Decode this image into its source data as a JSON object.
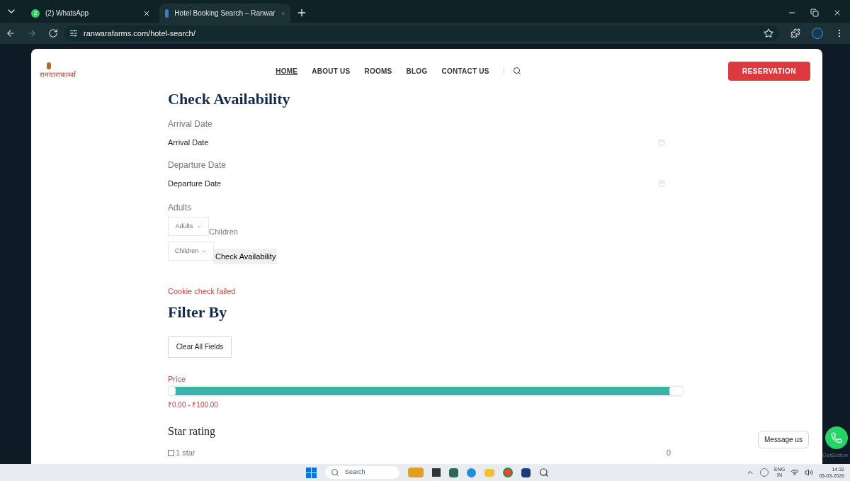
{
  "browser": {
    "tabs": [
      {
        "title": "(2) WhatsApp",
        "badge": "2",
        "selected": false
      },
      {
        "title": "Hotel Booking Search – Ranwar",
        "selected": true
      }
    ],
    "address": "ranwarafarms.com/hotel-search/"
  },
  "header": {
    "logo": "रानवाराफार्म्स",
    "nav": [
      {
        "label": "HOME",
        "selected": true
      },
      {
        "label": "ABOUT US",
        "selected": false
      },
      {
        "label": "ROOMS",
        "selected": false
      },
      {
        "label": "BLOG",
        "selected": false
      },
      {
        "label": "CONTACT US",
        "selected": false
      }
    ],
    "reservation": "RESERVATION"
  },
  "availability": {
    "title": "Check Availability",
    "dates": [
      {
        "label": "Arrival Date",
        "placeholder": "Arrival Date"
      },
      {
        "label": "Departure Date",
        "placeholder": "Departure Date"
      }
    ],
    "adults_label": "Adults",
    "adults_select": "Adults",
    "children_label": "Children",
    "children_select": "Children",
    "submit": "Check Availability",
    "error": "Cookie check failed"
  },
  "filter": {
    "title": "Filter By",
    "clear": "Clear All Fields",
    "price_label": "Price",
    "price": {
      "level": 1
    },
    "price_range": "₹0.00 - ₹100.00",
    "star_title": "Star rating",
    "stars": [
      {
        "label": "1 star",
        "checked": false,
        "count": "0"
      }
    ]
  },
  "chat": {
    "message": "Message us",
    "credit": "GetButton"
  },
  "taskbar": {
    "search": "Search",
    "lang": "ENG",
    "region": "IN",
    "time": "14:32",
    "date": "05-03-2026"
  }
}
